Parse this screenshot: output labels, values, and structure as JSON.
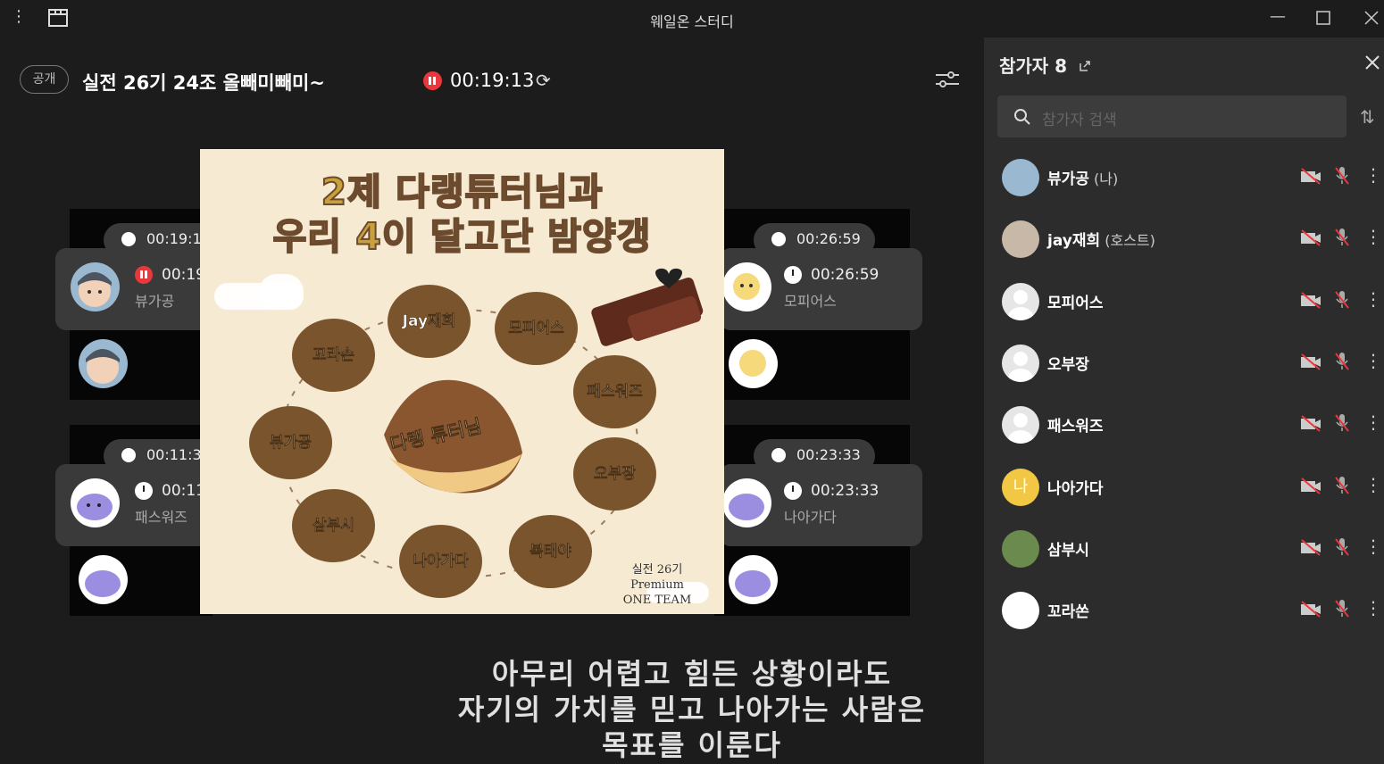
{
  "window": {
    "title": "웨일온 스터디"
  },
  "header": {
    "badge": "공개",
    "room_title": "실전 26기 24조 올빼미빼미~",
    "timer": "00:19:13"
  },
  "tiles": [
    {
      "pill_time": "00:19:1",
      "card_time": "00:19",
      "name": "뷰가공"
    },
    {
      "pill_time": "00:26:59",
      "card_time": "00:26:59",
      "name": "모피어스"
    },
    {
      "pill_time": "00:11:3",
      "card_time": "00:11",
      "name": "패스워즈"
    },
    {
      "pill_time": "00:23:33",
      "card_time": "00:23:33",
      "name": "나아가다"
    }
  ],
  "poster": {
    "title_line1": "2제  다랭튜터님과",
    "title_line2": "우리 4이 달고단 밤양갱",
    "center": "다랭 튜터님",
    "circles": [
      "Jay재희",
      "모피어스",
      "꼬라손",
      "패스워즈",
      "뷰가공",
      "오부장",
      "삼부시",
      "나아가다",
      "복태야"
    ],
    "footer": [
      "실전 26기",
      "Premium",
      "ONE TEAM"
    ]
  },
  "subtitle": [
    "아무리 어렵고 힘든 상황이라도",
    "자기의 가치를 믿고 나아가는 사람은",
    "목표를 이룬다"
  ],
  "sidebar": {
    "title": "참가자 8",
    "search_placeholder": "참가자 검색",
    "participants": [
      {
        "name": "뷰가공",
        "tag": "(나)"
      },
      {
        "name": "jay재희",
        "tag": "(호스트)"
      },
      {
        "name": "모피어스",
        "tag": ""
      },
      {
        "name": "오부장",
        "tag": ""
      },
      {
        "name": "패스워즈",
        "tag": ""
      },
      {
        "name": "나아가다",
        "tag": "",
        "initial": "나"
      },
      {
        "name": "삼부시",
        "tag": ""
      },
      {
        "name": "꼬라쏜",
        "tag": ""
      }
    ]
  },
  "colors": {
    "record": "#e8383d",
    "initial_avatar": "#f2c744",
    "poster_bg": "#f7ead2",
    "circle": "#7a542d"
  }
}
